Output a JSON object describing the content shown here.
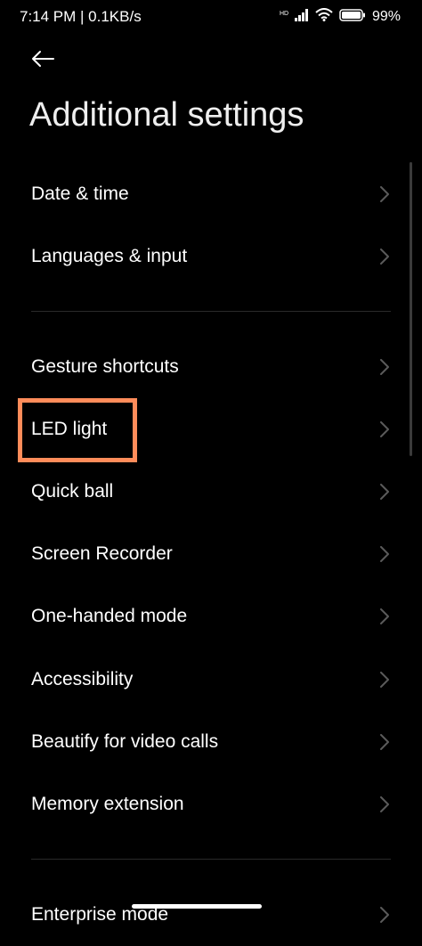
{
  "status_bar": {
    "time": "7:14 PM | 0.1KB/s",
    "network_type": "HD",
    "battery_percent": "99%",
    "icons": [
      "hd-icon",
      "signal-icon",
      "wifi-icon",
      "battery-icon"
    ]
  },
  "header": {
    "back_icon": "arrow-left-icon",
    "title": "Additional settings"
  },
  "groups": [
    {
      "items": [
        {
          "label": "Date & time"
        },
        {
          "label": "Languages & input"
        }
      ]
    },
    {
      "items": [
        {
          "label": "Gesture shortcuts"
        },
        {
          "label": "LED light",
          "highlighted": true
        },
        {
          "label": "Quick ball"
        },
        {
          "label": "Screen Recorder"
        },
        {
          "label": "One-handed mode"
        },
        {
          "label": "Accessibility"
        },
        {
          "label": "Beautify for video calls"
        },
        {
          "label": "Memory extension"
        }
      ]
    },
    {
      "items": [
        {
          "label": "Enterprise mode"
        }
      ]
    }
  ],
  "chevron_icon": "chevron-right-icon",
  "colors": {
    "background": "#000000",
    "text": "#ffffff",
    "chevron": "#5a5a5a",
    "divider": "#2a2a2a",
    "highlight": "#ff8c5a"
  }
}
